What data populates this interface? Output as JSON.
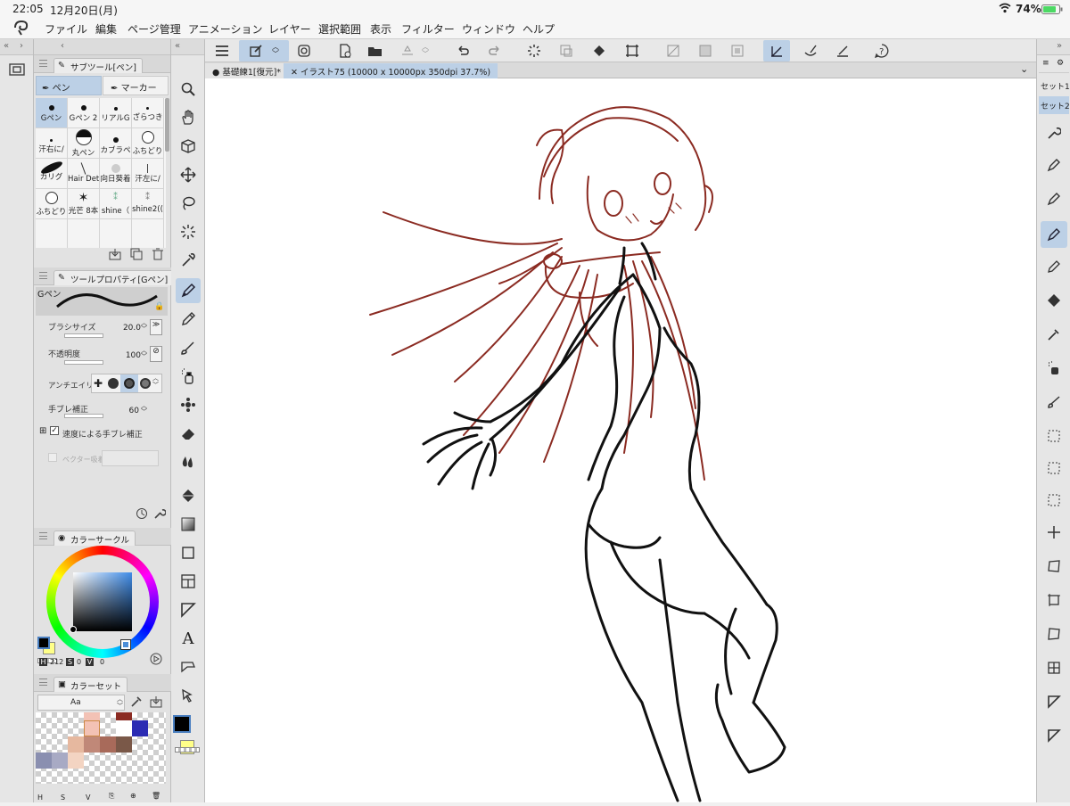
{
  "status": {
    "time": "22:05",
    "date": "12月20日(月)",
    "battery": "74%"
  },
  "menu": [
    "ファイル",
    "編集",
    "ページ管理",
    "アニメーション",
    "レイヤー",
    "選択範囲",
    "表示",
    "フィルター",
    "ウィンドウ",
    "ヘルプ"
  ],
  "subtool": {
    "title": "サブツール[ペン]",
    "tab_pen": "ペン",
    "tab_marker": "マーカー",
    "brushes": [
      "Gペン",
      "Gペン 2",
      "リアルG",
      "ざらつき",
      "汗右に/",
      "丸ペン",
      "カブラペ",
      "ふちどり",
      "カリグ",
      "Hair Det",
      "向日葵着",
      "汗左に/",
      "ふちどり",
      "光芒 8本",
      "shine（",
      "shine2(("
    ]
  },
  "toolprop": {
    "title": "ツールプロパティ[Gペン]",
    "brush_name": "Gペン",
    "brush_size_label": "ブラシサイズ",
    "brush_size": "20.0",
    "opacity_label": "不透明度",
    "opacity": "100",
    "antialias_label": "アンチエイリア",
    "stabilization_label": "手ブレ補正",
    "stabilization": "60",
    "speed_stabilization_label": "速度による手ブレ補正",
    "vector_label": "ベクター吸着"
  },
  "colorcircle": {
    "title": "カラーサークル",
    "h_label": "H",
    "h": "212",
    "s_label": "S",
    "s": "0",
    "v_label": "V",
    "v": "0"
  },
  "colorset": {
    "title": "カラーセット",
    "font_label": "Aa",
    "h": "H",
    "s": "S",
    "v": "V"
  },
  "doc_tabs": {
    "tab1": "基礎練1[復元]*",
    "tab2": "イラスト75 (10000 x 10000px 350dpi 37.7%)"
  },
  "right": {
    "set1": "セット1",
    "set2": "セット2"
  },
  "colors": {
    "accent_sel": "#bcd0e6",
    "sketch_red": "#8b2b22",
    "line_black": "#111111",
    "main_color": "#000000",
    "sub_color": "#ffff88"
  }
}
